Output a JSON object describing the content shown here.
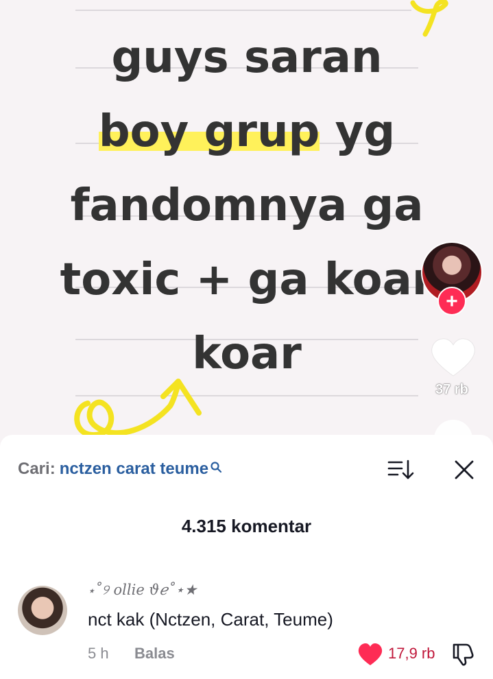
{
  "video": {
    "caption": {
      "line1": "guys saran",
      "line2_highlight": "boy grup",
      "line2_rest": " yg",
      "line3": "fandomnya ga",
      "line4": "toxic + ga koar",
      "line5": "koar"
    },
    "like_count": "37 rb",
    "colors": {
      "highlight": "#fff15a",
      "follow": "#fe2c55"
    }
  },
  "comments_sheet": {
    "search_prefix": "Cari:",
    "search_term": "nctzen carat teume",
    "count_label": "4.315 komentar",
    "comments": [
      {
        "username": "⋆˚୨ ollie ϑℯ˚⋆★",
        "text": "nct kak (Nctzen, Carat, Teume)",
        "time": "5 h",
        "reply_label": "Balas",
        "likes": "17,9 rb",
        "liked": true
      }
    ],
    "colors": {
      "like": "#fe2c55",
      "search_link": "#2a5e9f"
    }
  }
}
